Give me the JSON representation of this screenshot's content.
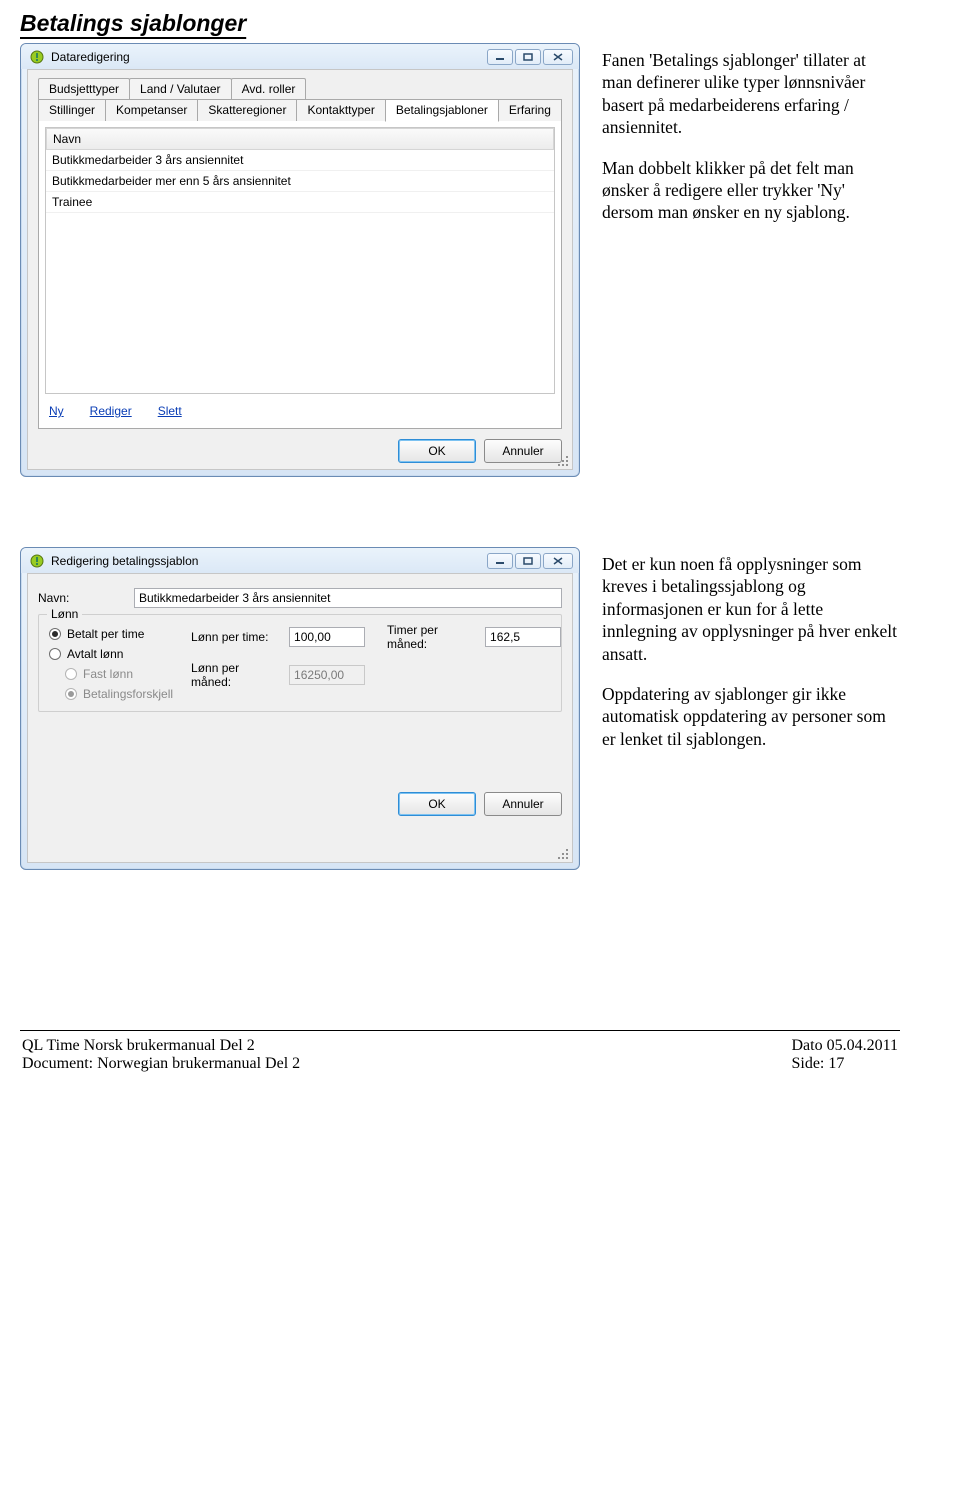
{
  "heading": "Betalings sjablonger",
  "para1": "Fanen 'Betalings sjablonger' tillater at man definerer ulike typer lønnsnivåer basert på medarbeiderens erfaring / ansiennitet.",
  "para2": "Man dobbelt klikker på det felt man ønsker å redigere eller trykker 'Ny' dersom man ønsker en ny sjablong.",
  "para3": "Det er kun noen få opplysninger som kreves i betalingssjablong og informasjonen er kun for å lette innlegning av opplysninger på hver enkelt ansatt.",
  "para4": "Oppdatering av sjablonger gir ikke automatisk oppdatering av personer som er lenket til sjablongen.",
  "dialog1": {
    "title": "Dataredigering",
    "tabsTop": [
      "Budsjetttyper",
      "Land / Valutaer",
      "Avd. roller"
    ],
    "tabsBottom": [
      "Stillinger",
      "Kompetanser",
      "Skatteregioner",
      "Kontakttyper",
      "Betalingsjabloner",
      "Erfaring"
    ],
    "tabActive": "Betalingsjabloner",
    "colHeader": "Navn",
    "rows": [
      "Butikkmedarbeider 3 års ansiennitet",
      "Butikkmedarbeider mer enn 5 års ansiennitet",
      "Trainee"
    ],
    "links": {
      "ny": "Ny",
      "rediger": "Rediger",
      "slett": "Slett"
    },
    "ok": "OK",
    "cancel": "Annuler"
  },
  "dialog2": {
    "title": "Redigering betalingssjablon",
    "nameLabel": "Navn:",
    "nameValue": "Butikkmedarbeider 3 års ansiennitet",
    "groupTitle": "Lønn",
    "radios": {
      "perTime": "Betalt per time",
      "avtalt": "Avtalt lønn",
      "fast": "Fast lønn",
      "forskjell": "Betalingsforskjell"
    },
    "fields": {
      "lpt": "Lønn per time:",
      "lptVal": "100,00",
      "tpm": "Timer per måned:",
      "tpmVal": "162,5",
      "lpm": "Lønn per måned:",
      "lpmVal": "16250,00"
    },
    "ok": "OK",
    "cancel": "Annuler"
  },
  "footer": {
    "leftTop": "QL Time Norsk brukermanual Del 2",
    "leftBottom": "Document: Norwegian brukermanual Del 2",
    "rightTop": "Dato 05.04.2011",
    "rightBottom": "Side: 17"
  }
}
